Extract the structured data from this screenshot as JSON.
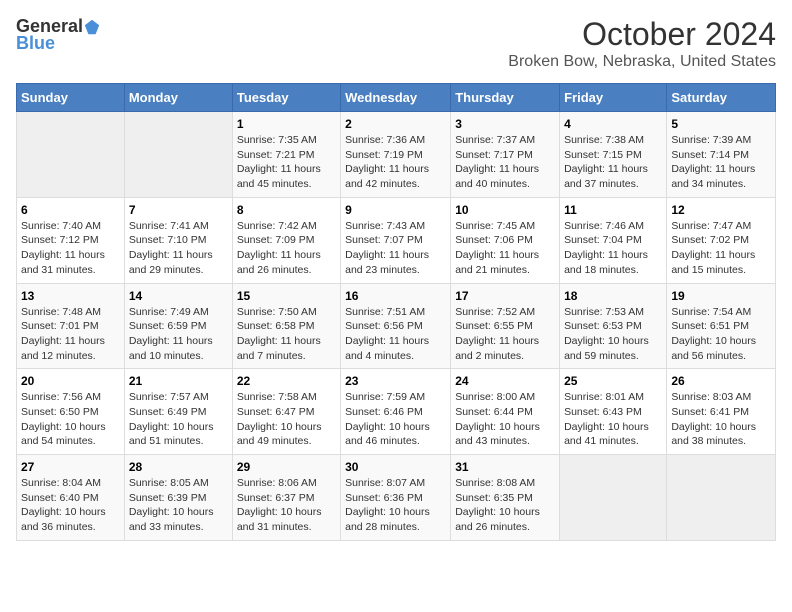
{
  "header": {
    "logo_general": "General",
    "logo_blue": "Blue",
    "title": "October 2024",
    "subtitle": "Broken Bow, Nebraska, United States"
  },
  "columns": [
    "Sunday",
    "Monday",
    "Tuesday",
    "Wednesday",
    "Thursday",
    "Friday",
    "Saturday"
  ],
  "weeks": [
    [
      {
        "day": "",
        "info": ""
      },
      {
        "day": "",
        "info": ""
      },
      {
        "day": "1",
        "info": "Sunrise: 7:35 AM\nSunset: 7:21 PM\nDaylight: 11 hours and 45 minutes."
      },
      {
        "day": "2",
        "info": "Sunrise: 7:36 AM\nSunset: 7:19 PM\nDaylight: 11 hours and 42 minutes."
      },
      {
        "day": "3",
        "info": "Sunrise: 7:37 AM\nSunset: 7:17 PM\nDaylight: 11 hours and 40 minutes."
      },
      {
        "day": "4",
        "info": "Sunrise: 7:38 AM\nSunset: 7:15 PM\nDaylight: 11 hours and 37 minutes."
      },
      {
        "day": "5",
        "info": "Sunrise: 7:39 AM\nSunset: 7:14 PM\nDaylight: 11 hours and 34 minutes."
      }
    ],
    [
      {
        "day": "6",
        "info": "Sunrise: 7:40 AM\nSunset: 7:12 PM\nDaylight: 11 hours and 31 minutes."
      },
      {
        "day": "7",
        "info": "Sunrise: 7:41 AM\nSunset: 7:10 PM\nDaylight: 11 hours and 29 minutes."
      },
      {
        "day": "8",
        "info": "Sunrise: 7:42 AM\nSunset: 7:09 PM\nDaylight: 11 hours and 26 minutes."
      },
      {
        "day": "9",
        "info": "Sunrise: 7:43 AM\nSunset: 7:07 PM\nDaylight: 11 hours and 23 minutes."
      },
      {
        "day": "10",
        "info": "Sunrise: 7:45 AM\nSunset: 7:06 PM\nDaylight: 11 hours and 21 minutes."
      },
      {
        "day": "11",
        "info": "Sunrise: 7:46 AM\nSunset: 7:04 PM\nDaylight: 11 hours and 18 minutes."
      },
      {
        "day": "12",
        "info": "Sunrise: 7:47 AM\nSunset: 7:02 PM\nDaylight: 11 hours and 15 minutes."
      }
    ],
    [
      {
        "day": "13",
        "info": "Sunrise: 7:48 AM\nSunset: 7:01 PM\nDaylight: 11 hours and 12 minutes."
      },
      {
        "day": "14",
        "info": "Sunrise: 7:49 AM\nSunset: 6:59 PM\nDaylight: 11 hours and 10 minutes."
      },
      {
        "day": "15",
        "info": "Sunrise: 7:50 AM\nSunset: 6:58 PM\nDaylight: 11 hours and 7 minutes."
      },
      {
        "day": "16",
        "info": "Sunrise: 7:51 AM\nSunset: 6:56 PM\nDaylight: 11 hours and 4 minutes."
      },
      {
        "day": "17",
        "info": "Sunrise: 7:52 AM\nSunset: 6:55 PM\nDaylight: 11 hours and 2 minutes."
      },
      {
        "day": "18",
        "info": "Sunrise: 7:53 AM\nSunset: 6:53 PM\nDaylight: 10 hours and 59 minutes."
      },
      {
        "day": "19",
        "info": "Sunrise: 7:54 AM\nSunset: 6:51 PM\nDaylight: 10 hours and 56 minutes."
      }
    ],
    [
      {
        "day": "20",
        "info": "Sunrise: 7:56 AM\nSunset: 6:50 PM\nDaylight: 10 hours and 54 minutes."
      },
      {
        "day": "21",
        "info": "Sunrise: 7:57 AM\nSunset: 6:49 PM\nDaylight: 10 hours and 51 minutes."
      },
      {
        "day": "22",
        "info": "Sunrise: 7:58 AM\nSunset: 6:47 PM\nDaylight: 10 hours and 49 minutes."
      },
      {
        "day": "23",
        "info": "Sunrise: 7:59 AM\nSunset: 6:46 PM\nDaylight: 10 hours and 46 minutes."
      },
      {
        "day": "24",
        "info": "Sunrise: 8:00 AM\nSunset: 6:44 PM\nDaylight: 10 hours and 43 minutes."
      },
      {
        "day": "25",
        "info": "Sunrise: 8:01 AM\nSunset: 6:43 PM\nDaylight: 10 hours and 41 minutes."
      },
      {
        "day": "26",
        "info": "Sunrise: 8:03 AM\nSunset: 6:41 PM\nDaylight: 10 hours and 38 minutes."
      }
    ],
    [
      {
        "day": "27",
        "info": "Sunrise: 8:04 AM\nSunset: 6:40 PM\nDaylight: 10 hours and 36 minutes."
      },
      {
        "day": "28",
        "info": "Sunrise: 8:05 AM\nSunset: 6:39 PM\nDaylight: 10 hours and 33 minutes."
      },
      {
        "day": "29",
        "info": "Sunrise: 8:06 AM\nSunset: 6:37 PM\nDaylight: 10 hours and 31 minutes."
      },
      {
        "day": "30",
        "info": "Sunrise: 8:07 AM\nSunset: 6:36 PM\nDaylight: 10 hours and 28 minutes."
      },
      {
        "day": "31",
        "info": "Sunrise: 8:08 AM\nSunset: 6:35 PM\nDaylight: 10 hours and 26 minutes."
      },
      {
        "day": "",
        "info": ""
      },
      {
        "day": "",
        "info": ""
      }
    ]
  ]
}
